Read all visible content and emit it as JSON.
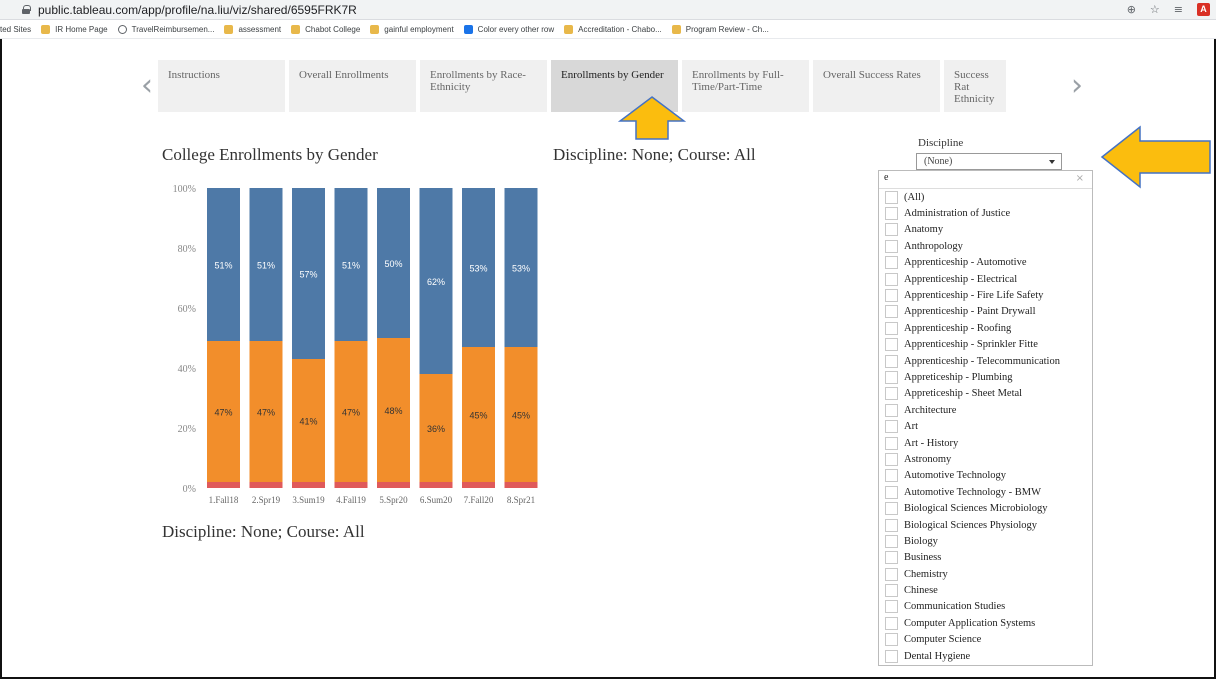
{
  "browser": {
    "url": "public.tableau.com/app/profile/na.liu/viz/shared/6595FRK7R",
    "bookmarks": [
      "ted Sites",
      "IR Home Page",
      "TravelReimbursemen...",
      "assessment",
      "Chabot College",
      "gainful employment",
      "Color every other row",
      "Accreditation - Chabo...",
      "Program Review - Ch..."
    ]
  },
  "tabs": [
    {
      "label": "Instructions"
    },
    {
      "label": "Overall Enrollments"
    },
    {
      "label": "Enrollments by Race-Ethnicity"
    },
    {
      "label": "Enrollments by Gender"
    },
    {
      "label": "Enrollments by Full-Time/Part-Time"
    },
    {
      "label": "Overall Success Rates"
    },
    {
      "label": "Success Rat Ethnicity"
    }
  ],
  "nav": {
    "prev": "‹",
    "next": "›"
  },
  "chart_title": "College Enrollments by Gender",
  "discipline_text": "Discipline: None; Course: All",
  "chart_data": {
    "type": "bar",
    "stacked": true,
    "title": "College Enrollments by Gender",
    "categories": [
      "1.Fall18",
      "2.Spr19",
      "3.Sum19",
      "4.Fall19",
      "5.Spr20",
      "6.Sum20",
      "7.Fall20",
      "8.Spr21"
    ],
    "series": [
      {
        "values": [
          2,
          2,
          2,
          2,
          2,
          2,
          2,
          2
        ],
        "color": "#e05a5a"
      },
      {
        "values": [
          47,
          47,
          41,
          47,
          48,
          36,
          45,
          45
        ],
        "labels": [
          "47%",
          "47%",
          "41%",
          "47%",
          "48%",
          "36%",
          "45%",
          "45%"
        ],
        "color": "#f28e2b"
      },
      {
        "values": [
          51,
          51,
          57,
          51,
          50,
          62,
          53,
          53
        ],
        "labels": [
          "51%",
          "51%",
          "57%",
          "51%",
          "50%",
          "62%",
          "53%",
          "53%"
        ],
        "color": "#4e79a7"
      }
    ],
    "yticks": [
      "0%",
      "20%",
      "40%",
      "60%",
      "80%",
      "100%"
    ],
    "ylim": [
      0,
      100
    ],
    "grid": false
  },
  "filter": {
    "label": "Discipline",
    "selected": "(None)",
    "search_text": "e",
    "clear_glyph": "×",
    "options": [
      "(All)",
      "Administration of Justice",
      "Anatomy",
      "Anthropology",
      "Apprenticeship - Automotive",
      "Apprenticeship - Electrical",
      "Apprenticeship - Fire Life Safety",
      "Apprenticeship - Paint Drywall",
      "Apprenticeship - Roofing",
      "Apprenticeship - Sprinkler Fitte",
      "Apprenticeship - Telecommunication",
      "Appreticeship - Plumbing",
      "Appreticeship - Sheet Metal",
      "Architecture",
      "Art",
      "Art - History",
      "Astronomy",
      "Automotive Technology",
      "Automotive Technology - BMW",
      "Biological Sciences Microbiology",
      "Biological Sciences Physiology",
      "Biology",
      "Business",
      "Chemistry",
      "Chinese",
      "Communication Studies",
      "Computer Application Systems",
      "Computer Science",
      "Dental Hygiene"
    ]
  },
  "colors": {
    "arrow_fill": "#fbbd0e",
    "arrow_stroke": "#4472c4",
    "active_tab": "#d8d8d8"
  }
}
